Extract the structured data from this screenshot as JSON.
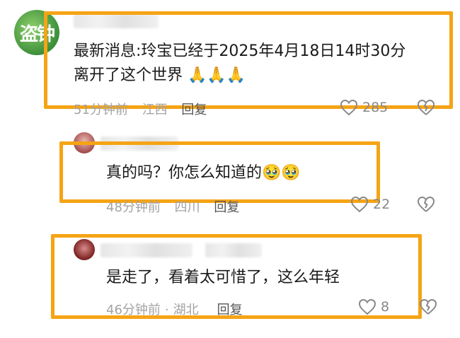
{
  "comments": [
    {
      "text_line1": "最新消息:玲宝已经于2025年4月18日14时30分",
      "text_line2": "离开了这个世界",
      "emoji": "🙏🙏🙏",
      "time": "51分钟前",
      "location": "江西",
      "reply_label": "回复",
      "likes": "285",
      "avatar_glyph": "盗钟"
    },
    {
      "text": "真的吗？你怎么知道的",
      "emoji": "🥹🥹",
      "time": "48分钟前",
      "location": "四川",
      "reply_label": "回复",
      "likes": "22"
    },
    {
      "text": "是走了，看着太可惜了，这么年轻",
      "time": "46分钟前",
      "separator": "·",
      "location": "湖北",
      "reply_label": "回复",
      "likes": "8"
    }
  ],
  "colors": {
    "highlight": "#f5a415",
    "meta_text": "#a3a3a3"
  }
}
